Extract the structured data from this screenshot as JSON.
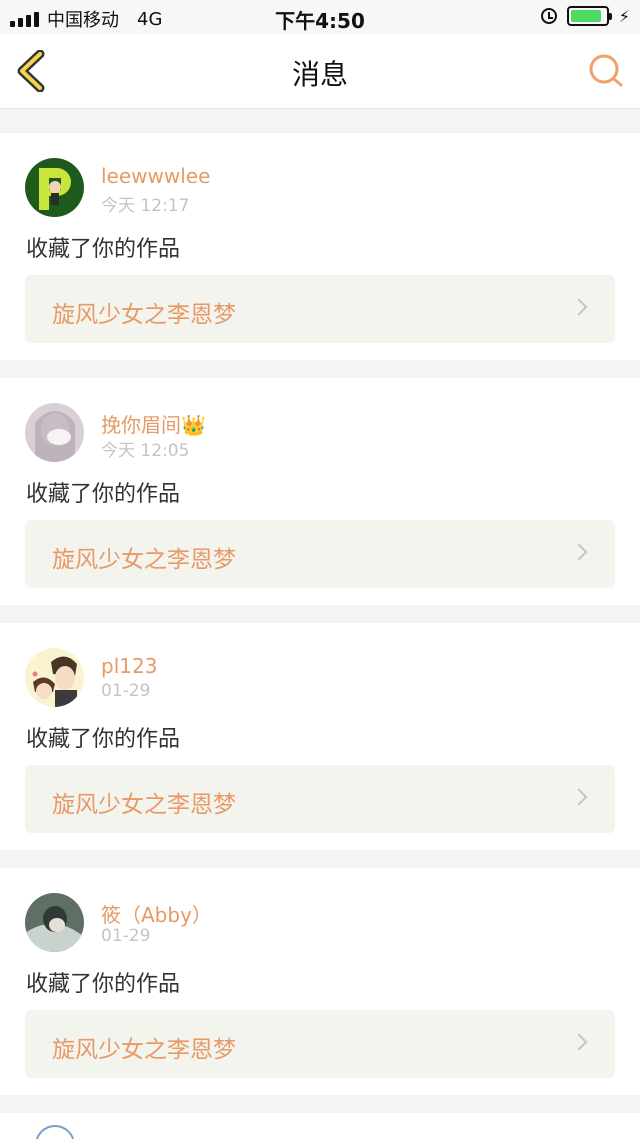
{
  "status_bar": {
    "carrier": "中国移动",
    "network": "4G",
    "time": "下午4:50",
    "alarm_icon": "alarm-clock-icon",
    "battery_level": 0.9,
    "battery_color": "#4cd964",
    "charging_icon": "bolt-icon"
  },
  "nav": {
    "title": "消息",
    "back_icon": "chevron-left-icon",
    "search_icon": "search-icon",
    "accent_color": "#f0a06a"
  },
  "messages": [
    {
      "username": "leewwwlee",
      "time": "今天 12:17",
      "action": "收藏了你的作品",
      "work_title": "旋风少女之李恩梦"
    },
    {
      "username": "挽你眉间👑",
      "time": "今天 12:05",
      "action": "收藏了你的作品",
      "work_title": "旋风少女之李恩梦"
    },
    {
      "username": "pl123",
      "time": "01-29",
      "action": "收藏了你的作品",
      "work_title": "旋风少女之李恩梦"
    },
    {
      "username": "筱（Abby）",
      "time": "01-29",
      "action": "收藏了你的作品",
      "work_title": "旋风少女之李恩梦"
    }
  ]
}
